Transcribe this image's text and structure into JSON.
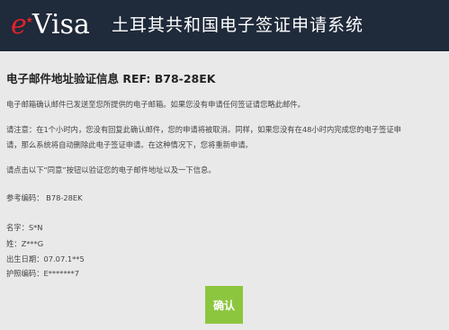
{
  "header": {
    "logo_e": "e",
    "logo_star": "★",
    "logo_visa": "Visa",
    "title": "土耳其共和国电子签证申请系统"
  },
  "main": {
    "heading": "电子邮件地址验证信息 REF: B78-28EK",
    "para1": "电子邮箱确认邮件已发送至您所提供的电子邮箱。如果您没有申请任何签证请您略此邮件。",
    "para2_line1": "请注意：在1个小时内，您没有回复此确认邮件，您的申请将被取消。同样，如果您没有在48小时内完成您的电子签证申",
    "para2_line2": "请，那么系统将自动删除此电子签证申请。在这种情况下，您将重新申请。",
    "para3": "请点击以下“同意”按钮以验证您的电子邮件地址以及一下信息。",
    "reference": "参考编码： B78-28EK",
    "fields": {
      "name": "名字：S*N",
      "surname": "姓：Z***G",
      "dob": "出生日期：07.07.1**5",
      "passport": "护照编码：E*******7"
    },
    "confirm_label": "确认"
  }
}
